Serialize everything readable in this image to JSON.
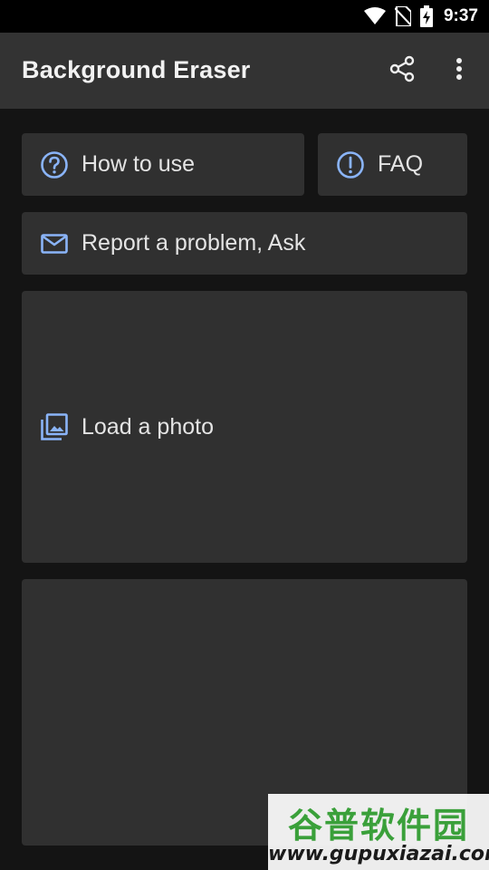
{
  "status_bar": {
    "time": "9:37",
    "icons": [
      "wifi-icon",
      "no-sim-icon",
      "battery-charging-icon"
    ]
  },
  "app_bar": {
    "title": "Background Eraser",
    "actions": [
      "share-icon",
      "more-vert-icon"
    ]
  },
  "cards": {
    "how_to_use": {
      "label": "How to use",
      "icon": "help-circle-icon"
    },
    "faq": {
      "label": "FAQ",
      "icon": "exclamation-circle-icon"
    },
    "report": {
      "label": "Report a problem, Ask",
      "icon": "mail-icon"
    },
    "load_photo": {
      "label": "Load a photo",
      "icon": "photo-library-icon"
    }
  },
  "watermark": {
    "title": "谷普软件园",
    "url": "www.gupuxiazai.com"
  },
  "colors": {
    "background": "#141414",
    "app_bar": "#333333",
    "card": "#303030",
    "icon_accent": "#8ab4f8"
  }
}
